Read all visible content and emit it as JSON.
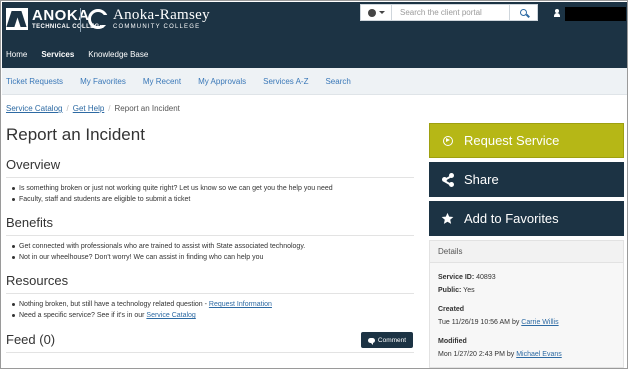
{
  "header": {
    "logo_tech": {
      "big": "ANOKA",
      "small": "TECHNICAL COLLEGE"
    },
    "logo_ar": {
      "big": "Anoka-Ramsey",
      "small": "COMMUNITY COLLEGE"
    },
    "search_placeholder": "Search the client portal",
    "nav": [
      "Home",
      "Services",
      "Knowledge Base"
    ],
    "active_nav": "Services"
  },
  "sub_nav": [
    "Ticket Requests",
    "My Favorites",
    "My Recent",
    "My Approvals",
    "Services A-Z",
    "Search"
  ],
  "breadcrumb": {
    "items": [
      "Service Catalog",
      "Get Help"
    ],
    "current": "Report an Incident",
    "separator": "/"
  },
  "page": {
    "title": "Report an Incident",
    "overview": {
      "heading": "Overview",
      "bullets": [
        "Is something broken or just not working quite right? Let us know so we can get you the help you need",
        "Faculty, staff and students are eligible to submit a ticket"
      ]
    },
    "benefits": {
      "heading": "Benefits",
      "bullets": [
        "Get connected with professionals who are trained to assist with State associated technology.",
        "Not in our wheelhouse? Don't worry! We can assist in finding who can help you"
      ]
    },
    "resources": {
      "heading": "Resources",
      "item1_text": "Nothing broken, but still have a technology related question - ",
      "item1_link": "Request Information",
      "item2_text": "Need a specific service? See if it's in our ",
      "item2_link": "Service Catalog"
    },
    "feed": {
      "heading": "Feed (0)",
      "comment_label": "Comment"
    }
  },
  "actions": {
    "request": "Request Service",
    "share": "Share",
    "favorite": "Add to Favorites"
  },
  "details": {
    "heading": "Details",
    "service_id_label": "Service ID:",
    "service_id": "40893",
    "public_label": "Public:",
    "public": "Yes",
    "created_label": "Created",
    "created_date": "Tue 11/26/19 10:56 AM by ",
    "created_by": "Carrie Willis",
    "modified_label": "Modified",
    "modified_date": "Mon 1/27/20 2:43 PM by ",
    "modified_by": "Michael Evans"
  },
  "colors": {
    "primary": "#1c3344",
    "accent": "#b6b716",
    "link": "#2d6aa3"
  },
  "icons": [
    "globe-icon",
    "search-icon",
    "user-icon",
    "arrow-circle-icon",
    "share-icon",
    "star-icon",
    "comment-icon"
  ]
}
